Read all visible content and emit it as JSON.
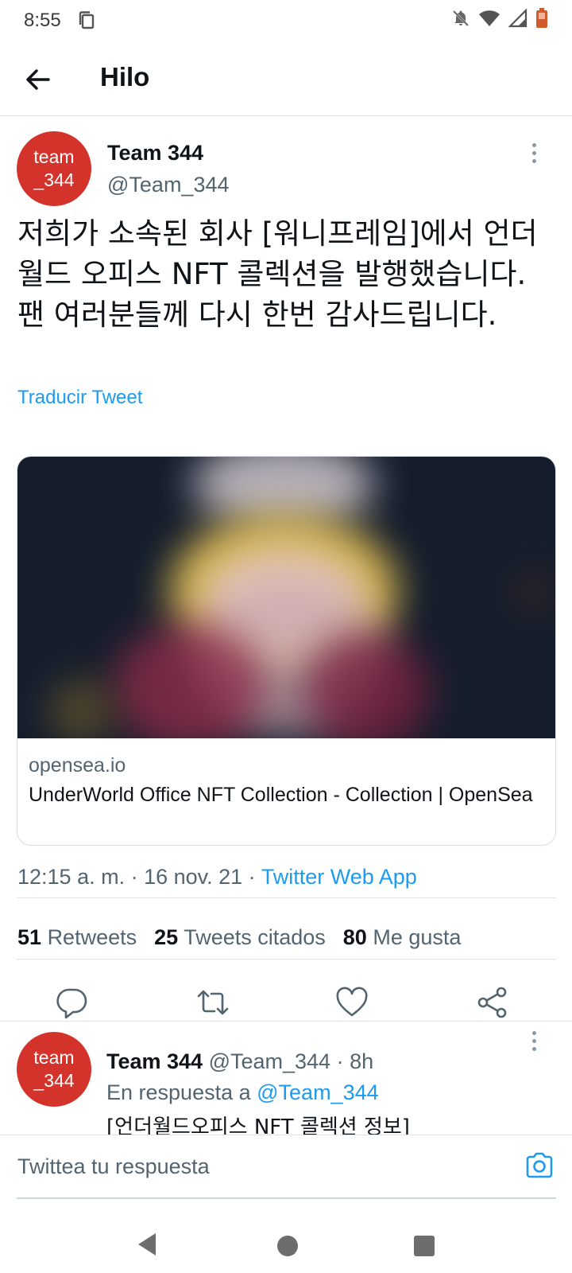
{
  "status_bar": {
    "time": "8:55",
    "icons": [
      "copy-icon",
      "notifications-off-icon",
      "wifi-icon",
      "signal-icon",
      "battery-icon"
    ]
  },
  "app_bar": {
    "title": "Hilo"
  },
  "tweet": {
    "avatar_line1": "team",
    "avatar_line2": "_344",
    "display_name": "Team 344",
    "handle": "@Team_344",
    "text": "저희가 소속된 회사 [워니프레임]에서 언더월드 오피스 NFT 콜렉션을 발행했습니다. 팬 여러분들께 다시 한번 감사드립니다.",
    "translate_label": "Traducir Tweet",
    "card": {
      "domain": "opensea.io",
      "title": "UnderWorld Office NFT Collection - Collection | OpenSea"
    },
    "timestamp": "12:15 a. m. · 16 nov. 21 · ",
    "source": "Twitter Web App",
    "stats": {
      "retweets_count": "51",
      "retweets_label": "Retweets",
      "quotes_count": "25",
      "quotes_label": "Tweets citados",
      "likes_count": "80",
      "likes_label": "Me gusta"
    }
  },
  "reply": {
    "avatar_line1": "team",
    "avatar_line2": "_344",
    "display_name": "Team 344",
    "meta": " @Team_344 · 8h",
    "replying_prefix": "En respuesta a ",
    "replying_mention": "@Team_344",
    "text": "[언더월드오피스 NFT 콜렉션 정보]"
  },
  "composer": {
    "placeholder": "Twittea tu respuesta"
  },
  "colors": {
    "accent": "#1d9bf0",
    "avatar": "#d4332c",
    "text": "#0f1419",
    "secondary": "#536471"
  }
}
